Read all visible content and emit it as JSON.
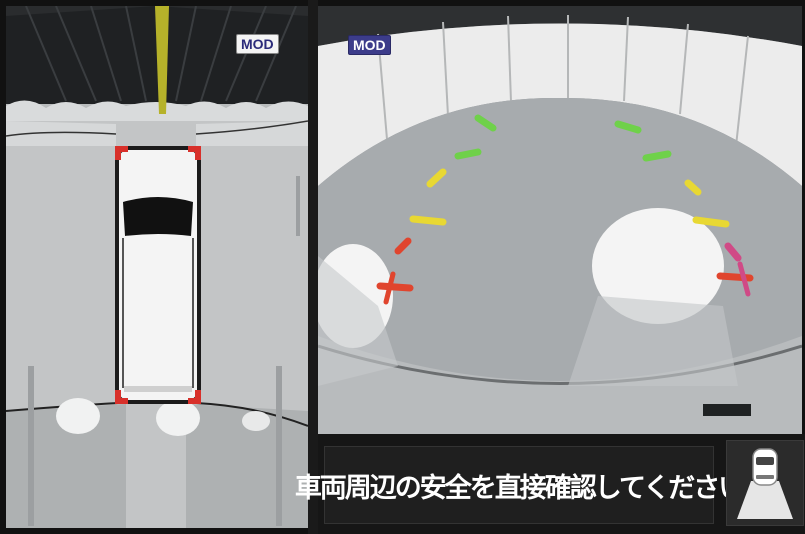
{
  "views": {
    "top_view": {
      "badge": "MOD"
    },
    "rear_view": {
      "badge": "MOD"
    }
  },
  "message": {
    "text": "車両周辺の安全を直接確認してください"
  },
  "guide_colors": {
    "green": "#6fd14a",
    "yellow": "#e8d833",
    "red": "#e0452e",
    "magenta": "#d04a86"
  },
  "icons": {
    "camera_mode": "car-front-camera-icon"
  }
}
